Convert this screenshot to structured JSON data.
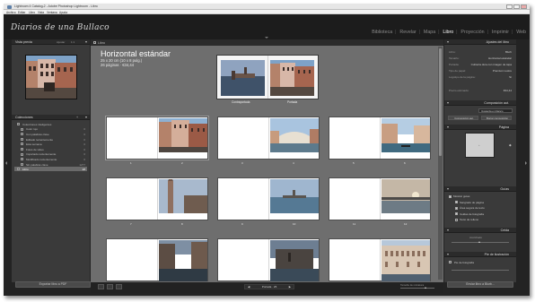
{
  "window": {
    "title": "Lightroom 4 Catalog-2 - Adobe Photoshop Lightroom - Libro",
    "menu": [
      "Archivo",
      "Editar",
      "Libro",
      "Vista",
      "Ventana",
      "Ayuda"
    ]
  },
  "identity_plate": "Diarios de una Bullaco",
  "modules": [
    {
      "label": "Biblioteca",
      "active": false
    },
    {
      "label": "Revelar",
      "active": false
    },
    {
      "label": "Mapa",
      "active": false
    },
    {
      "label": "Libro",
      "active": true
    },
    {
      "label": "Proyección",
      "active": false
    },
    {
      "label": "Imprimir",
      "active": false
    },
    {
      "label": "Web",
      "active": false
    }
  ],
  "left_panel": {
    "preview_header": "Vista previa",
    "preview_zoom": [
      "Ajustar",
      "1:1"
    ],
    "collections_header": "Colecciones",
    "collections": [
      {
        "name": "Colecciones inteligentes",
        "count": "",
        "level": 0
      },
      {
        "name": "Color rojo",
        "count": "0",
        "level": 1
      },
      {
        "name": "Con palabras clave",
        "count": "0",
        "level": 1
      },
      {
        "name": "Editado recientemente",
        "count": "0",
        "level": 1
      },
      {
        "name": "Esta semana",
        "count": "0",
        "level": 1
      },
      {
        "name": "Fotos de video",
        "count": "0",
        "level": 1
      },
      {
        "name": "Importado recientemente",
        "count": "0",
        "level": 1
      },
      {
        "name": "Modificado recientemente",
        "count": "0",
        "level": 1
      },
      {
        "name": "Sin palabras clave",
        "count": "1277",
        "level": 1
      },
      {
        "name": "Libro",
        "count": "28",
        "level": 0,
        "selected": true
      }
    ],
    "export_pdf": "Exportar libro a PDF"
  },
  "center": {
    "toolbar_label": "Libro",
    "book_title": "Horizontal estándar",
    "book_size": "25 x 20 cm (10 x 8 pulg.)",
    "book_pages": "26 páginas · €34,44",
    "cover_labels": [
      "Contraportada",
      "Portada"
    ],
    "page_numbers": [
      "1",
      "2",
      "3",
      "4",
      "5",
      "6",
      "7",
      "8",
      "9",
      "10",
      "11",
      "12"
    ],
    "nav_label": "Portada · 26",
    "zoom_label": "Tamaño de miniatura"
  },
  "right_panel": {
    "book_settings_header": "Ajustes del libro",
    "book_settings": [
      {
        "key": "Libro:",
        "value": "Blurb"
      },
      {
        "key": "Tamaño:",
        "value": "Horizontal estándar"
      },
      {
        "key": "Portada:",
        "value": "Cubierta dura con imagen de tapa"
      },
      {
        "key": "Tipo de papel:",
        "value": "Premium Lustre"
      },
      {
        "key": "Logotipo de la página:",
        "value": "Sí"
      },
      {
        "key": "Precio estimado:",
        "value": "€34,44"
      }
    ],
    "autolayout_header": "Composición aut.",
    "autolayout_preset": "Izquierda en blanco",
    "autolayout_buttons": [
      "Composición aut.",
      "Borrar composición"
    ],
    "page_header": "Página",
    "guides_header": "Guías",
    "guides": [
      {
        "label": "Mostrar guías",
        "on": true,
        "level": 0
      },
      {
        "label": "Sangrado de página",
        "on": true,
        "level": 1
      },
      {
        "label": "Área segura de texto",
        "on": true,
        "level": 1
      },
      {
        "label": "Celdas de fotografía",
        "on": true,
        "level": 1
      },
      {
        "label": "Texto de relleno",
        "on": false,
        "level": 1
      }
    ],
    "cell_header": "Celda",
    "cell_padding_label": "Acolchado",
    "caption_header": "Pie de ilustración",
    "caption_option": "Pie de fotografía",
    "send_button": "Enviar libro a Blurb..."
  }
}
